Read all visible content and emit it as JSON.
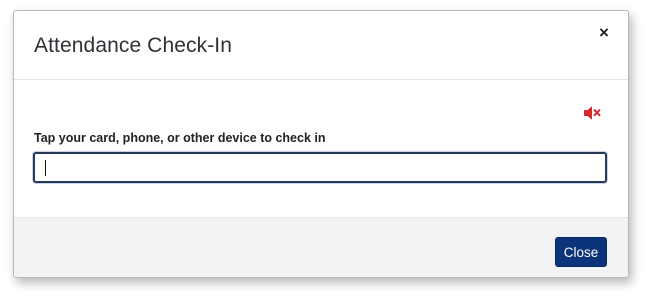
{
  "dialog": {
    "title": "Attendance Check-In",
    "close_icon": "close-icon",
    "close_glyph": "×"
  },
  "body": {
    "mute_icon": "speaker-muted-icon",
    "mute_icon_color": "#d42a2a",
    "field_label": "Tap your card, phone, or other device to check in",
    "input_value": "",
    "input_placeholder": ""
  },
  "footer": {
    "close_label": "Close",
    "close_button_color": "#0b347a"
  }
}
